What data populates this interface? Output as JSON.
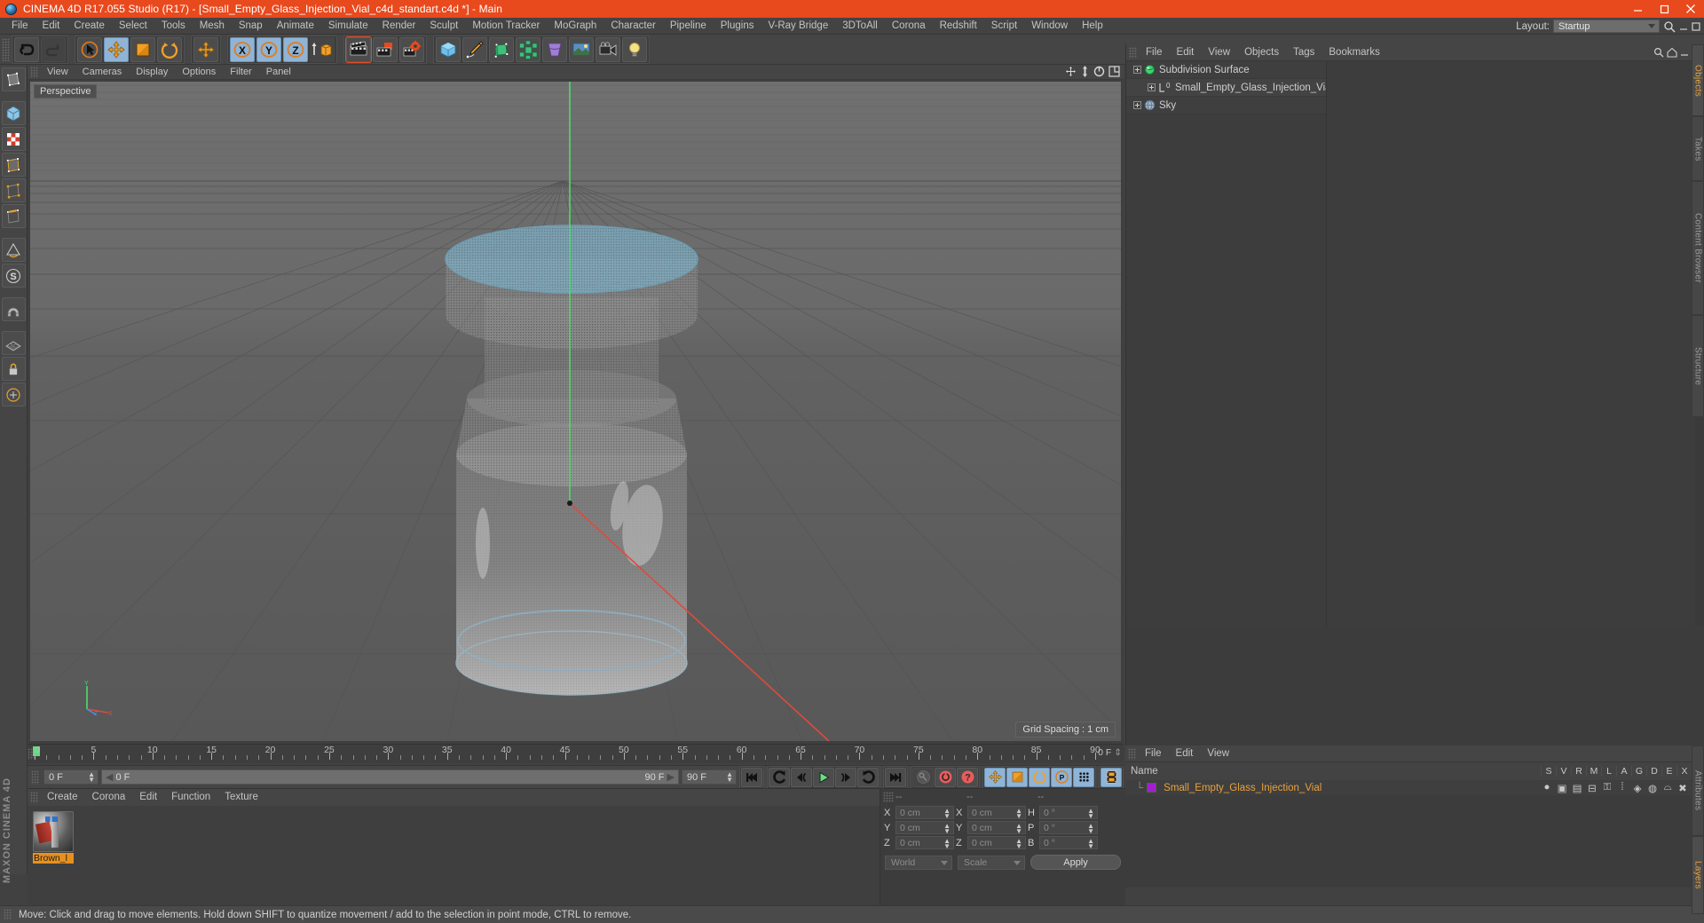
{
  "window": {
    "title": "CINEMA 4D R17.055 Studio (R17) - [Small_Empty_Glass_Injection_Vial_c4d_standart.c4d *] - Main",
    "minimize": "−",
    "maximize": "□",
    "close": "✕",
    "accent": "#e8491d"
  },
  "menubar": {
    "items": [
      "File",
      "Edit",
      "Create",
      "Select",
      "Tools",
      "Mesh",
      "Snap",
      "Animate",
      "Simulate",
      "Render",
      "Sculpt",
      "Motion Tracker",
      "MoGraph",
      "Character",
      "Pipeline",
      "Plugins",
      "V-Ray Bridge",
      "3DToAll",
      "Corona",
      "Redshift",
      "Script",
      "Window",
      "Help"
    ],
    "layout_label": "Layout:",
    "layout_value": "Startup"
  },
  "toolbar": {
    "groups": [
      {
        "name": "undo-redo",
        "buttons": [
          {
            "name": "undo-button",
            "icon": "undo-icon",
            "state": "normal"
          },
          {
            "name": "redo-button",
            "icon": "redo-icon",
            "state": "dim"
          }
        ]
      },
      {
        "name": "tools",
        "buttons": [
          {
            "name": "live-selection-button",
            "icon": "cursor-select-icon",
            "state": "normal"
          },
          {
            "name": "move-tool-button",
            "icon": "move-icon",
            "state": "active"
          },
          {
            "name": "scale-tool-button",
            "icon": "scale-icon",
            "state": "normal"
          },
          {
            "name": "rotate-tool-button",
            "icon": "rotate-icon",
            "state": "normal"
          }
        ]
      },
      {
        "name": "move-single",
        "buttons": [
          {
            "name": "move-axis-button",
            "icon": "move-icon",
            "state": "normal"
          }
        ]
      },
      {
        "name": "axis-locks",
        "buttons": [
          {
            "name": "lock-x-button",
            "icon": "x-axis-icon",
            "state": "active"
          },
          {
            "name": "lock-y-button",
            "icon": "y-axis-icon",
            "state": "active"
          },
          {
            "name": "lock-z-button",
            "icon": "z-axis-icon",
            "state": "active"
          },
          {
            "name": "world-object-axis-button",
            "icon": "world-coordinate-icon",
            "state": "normal"
          }
        ]
      },
      {
        "name": "render",
        "buttons": [
          {
            "name": "render-view-button",
            "icon": "render-view-icon",
            "state": "normal"
          },
          {
            "name": "render-to-picture-viewer-button",
            "icon": "render-picture-icon",
            "state": "normal"
          },
          {
            "name": "render-settings-button",
            "icon": "render-settings-icon",
            "state": "normal"
          }
        ]
      },
      {
        "name": "primitives",
        "buttons": [
          {
            "name": "add-cube-button",
            "icon": "cube-icon",
            "state": "normal"
          },
          {
            "name": "add-spline-button",
            "icon": "pen-spline-icon",
            "state": "normal"
          },
          {
            "name": "add-nurbs-button",
            "icon": "nurbs-icon",
            "state": "normal"
          },
          {
            "name": "add-array-button",
            "icon": "array-icon",
            "state": "normal"
          },
          {
            "name": "add-deformer-button",
            "icon": "deformer-icon",
            "state": "normal"
          },
          {
            "name": "add-environment-button",
            "icon": "environment-icon",
            "state": "normal"
          },
          {
            "name": "add-camera-button",
            "icon": "camera-icon",
            "state": "normal"
          },
          {
            "name": "add-light-button",
            "icon": "light-bulb-icon",
            "state": "normal"
          }
        ]
      }
    ]
  },
  "lefttoolbar": {
    "buttons": [
      {
        "name": "tool-make-editable",
        "icon": "editable-icon"
      },
      {
        "name": "tool-model-mode",
        "icon": "model-mode-icon"
      },
      {
        "name": "tool-texture-mode",
        "icon": "texture-mode-icon"
      },
      {
        "name": "tool-polygon-mode",
        "icon": "polygon-mode-icon"
      },
      {
        "name": "tool-point-mode",
        "icon": "point-mode-icon"
      },
      {
        "name": "tool-edge-mode",
        "icon": "edge-mode-icon"
      },
      {
        "name": "tool-object-axis",
        "icon": "object-axis-icon"
      },
      {
        "name": "tool-viewport-solo",
        "icon": "viewport-solo-icon"
      },
      {
        "name": "tool-enable-axis",
        "icon": "enable-axis-icon"
      },
      {
        "name": "tool-snap",
        "icon": "snap-magnet-icon"
      },
      {
        "name": "tool-workplane",
        "icon": "workplane-icon"
      },
      {
        "name": "tool-lock-workplane",
        "icon": "lock-icon"
      },
      {
        "name": "tool-workplane-mode",
        "icon": "workplane-mode-icon"
      }
    ],
    "brand": "MAXON CINEMA 4D"
  },
  "viewport": {
    "menu": [
      "View",
      "Cameras",
      "Display",
      "Options",
      "Filter",
      "Panel"
    ],
    "label": "Perspective",
    "grid_spacing": "Grid Spacing : 1 cm",
    "axis_labels": {
      "y": "Y",
      "x": "X",
      "z": "Z"
    },
    "background_top": "#6f6f6f",
    "background_bottom": "#5a5a5a"
  },
  "object_manager": {
    "menu": [
      "File",
      "Edit",
      "View",
      "Objects",
      "Tags",
      "Bookmarks"
    ],
    "rows": [
      {
        "name": "Subdivision Surface",
        "depth": 0,
        "icon": "subdivision-surface-icon",
        "tag": "hatch",
        "marker": "check"
      },
      {
        "name": "Small_Empty_Glass_Injection_Vial",
        "depth": 1,
        "icon": "polygon-object-icon",
        "tag": "swatch",
        "marker": "none"
      },
      {
        "name": "Sky",
        "depth": 0,
        "icon": "sky-icon",
        "tag": "hatch",
        "marker": "reddot"
      }
    ],
    "swatch_color": "#a020d0"
  },
  "right_tabs": {
    "top": [
      {
        "label": "Objects",
        "selected": true
      },
      {
        "label": "Takes",
        "selected": false
      },
      {
        "label": "Content Browser",
        "selected": false
      },
      {
        "label": "Structure",
        "selected": false
      }
    ],
    "bottom": [
      {
        "label": "Attributes",
        "selected": false
      },
      {
        "label": "Layers",
        "selected": true
      }
    ]
  },
  "layer_manager": {
    "menu": [
      "File",
      "Edit",
      "View"
    ],
    "name_header": "Name",
    "columns": [
      "S",
      "V",
      "R",
      "M",
      "L",
      "A",
      "G",
      "D",
      "E",
      "X"
    ],
    "rows": [
      {
        "name": "Small_Empty_Glass_Injection_Vial",
        "color": "#a020d0"
      }
    ]
  },
  "timeline": {
    "ticks": [
      0,
      5,
      10,
      15,
      20,
      25,
      30,
      35,
      40,
      45,
      50,
      55,
      60,
      65,
      70,
      75,
      80,
      85,
      90
    ],
    "min": 0,
    "max": 90,
    "current": "0 F",
    "end_label": "0 F"
  },
  "transport": {
    "current_frame": "0 F",
    "track_start": "0 F",
    "track_end": "90 F",
    "end_frame": "90 F",
    "buttons": [
      {
        "name": "go-to-start-button",
        "icon": "skip-start-icon",
        "state": "normal"
      },
      {
        "name": "play-reverse-loop-button",
        "icon": "loop-reverse-icon",
        "state": "normal"
      },
      {
        "name": "step-back-button",
        "icon": "step-back-icon",
        "state": "normal"
      },
      {
        "name": "play-button",
        "icon": "play-icon",
        "state": "normal"
      },
      {
        "name": "step-forward-button",
        "icon": "step-forward-icon",
        "state": "normal"
      },
      {
        "name": "play-loop-button",
        "icon": "loop-forward-icon",
        "state": "normal"
      },
      {
        "name": "go-to-end-button",
        "icon": "skip-end-icon",
        "state": "normal"
      },
      {
        "name": "autokey-button",
        "icon": "key-icon",
        "state": "dim"
      },
      {
        "name": "record-active-objects-button",
        "icon": "record-circle-icon",
        "state": "normal"
      },
      {
        "name": "record-button",
        "icon": "record-question-icon",
        "state": "normal"
      },
      {
        "name": "key-position-button",
        "icon": "move-icon",
        "state": "active"
      },
      {
        "name": "key-scale-button",
        "icon": "scale-icon",
        "state": "active"
      },
      {
        "name": "key-rotation-button",
        "icon": "rotate-icon",
        "state": "active"
      },
      {
        "name": "key-parameter-button",
        "icon": "parameter-p-icon",
        "state": "active"
      },
      {
        "name": "key-point-level-button",
        "icon": "dots-grid-icon",
        "state": "active"
      },
      {
        "name": "timeline-toggle-button",
        "icon": "film-strip-icon",
        "state": "active"
      }
    ]
  },
  "material_manager": {
    "menu": [
      "Create",
      "Corona",
      "Edit",
      "Function",
      "Texture"
    ],
    "materials": [
      {
        "name": "Brown_l",
        "label_color": "#e8901f"
      }
    ]
  },
  "coordinates": {
    "headers": [
      "--",
      "--",
      "--"
    ],
    "rows": [
      {
        "pos_label": "X",
        "pos_value": "0 cm",
        "size_label": "X",
        "size_value": "0 cm",
        "rot_label": "H",
        "rot_value": "0 °"
      },
      {
        "pos_label": "Y",
        "pos_value": "0 cm",
        "size_label": "Y",
        "size_value": "0 cm",
        "rot_label": "P",
        "rot_value": "0 °"
      },
      {
        "pos_label": "Z",
        "pos_value": "0 cm",
        "size_label": "Z",
        "size_value": "0 cm",
        "rot_label": "B",
        "rot_value": "0 °"
      }
    ],
    "system": "World",
    "mode": "Scale",
    "apply": "Apply"
  },
  "statusbar": {
    "message": "Move: Click and drag to move elements. Hold down SHIFT to quantize movement / add to the selection in point mode, CTRL to remove."
  }
}
